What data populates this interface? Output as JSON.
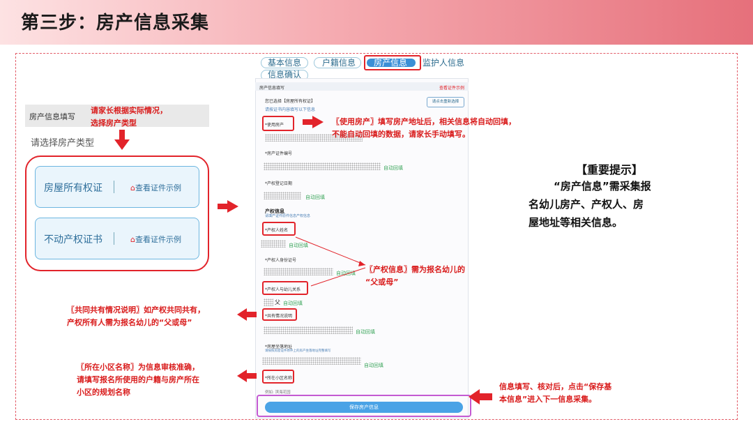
{
  "page_title": "第三步：房产信息采集",
  "left_panel": {
    "header": "房产信息填写",
    "select_prompt": "请选择房产类型",
    "options": [
      {
        "name": "房屋所有权证",
        "example": "查看证件示例"
      },
      {
        "name": "不动产权证书",
        "example": "查看证件示例"
      }
    ]
  },
  "notes": {
    "choose_type": [
      "请家长根据实际情况，",
      "选择房产类型"
    ],
    "use_property": [
      "〖使用房产〗填写房产地址后，相关信息将自动回填，",
      "不能自动回填的数据，请家长手动填写。"
    ],
    "owner_info": [
      "〖产权信息〗需为报名幼儿的",
      "“父或母”"
    ],
    "co_owner": [
      "〖共同共有情况说明〗如产权共同共有，",
      "产权所有人需为报名幼儿的“父或母”"
    ],
    "community": [
      "〖所在小区名称〗为信息审核准确，",
      "请填写报名所使用的户籍与房产所在",
      "小区的规划名称"
    ],
    "save": [
      "信息填写、核对后，点击“保存基",
      "本信息”进入下一信息采集。"
    ],
    "tip_title": "【重要提示】",
    "tip_body": [
      "“房产信息”需采集报",
      "名幼儿房产、产权人、房",
      "屋地址等相关信息。"
    ]
  },
  "tabs": [
    "基本信息",
    "户籍信息",
    "房产信息",
    "监护人信息",
    "信息确认"
  ],
  "form": {
    "header": "房产信息填写",
    "header_right": "查看证件示例",
    "selected_type": "您已选择【房屋所有权证】",
    "selected_hint": "请按证书内容填写以下信息",
    "reselect_button": "请点击重新选择",
    "use_property": "*使用房产",
    "cert_no": "*房产证件编号",
    "reg_date": "*产权登记日期",
    "owner_section": "产权信息",
    "owner_hint": "请填产证件原件信息产权信息",
    "owner_name": "*产权人姓名",
    "owner_id": "*产权人身份证号",
    "owner_relation": "*产权人与幼儿关系",
    "co_own": "*共有情况说明",
    "address": "*房屋坐落地址",
    "address_hint": "请按照房屋证件原件上的房产坐落地址完整填写",
    "community": "*所在小区名称",
    "community_value": "例如: 滨海花园",
    "autofill": "自动回填",
    "relation_value": "父",
    "save_button": "保存房产信息"
  },
  "colors": {
    "accent_red": "#e2232a",
    "tab_blue": "#3b8fd6",
    "save_blue": "#4aa3e6",
    "autofill_green": "#3aa55a"
  }
}
